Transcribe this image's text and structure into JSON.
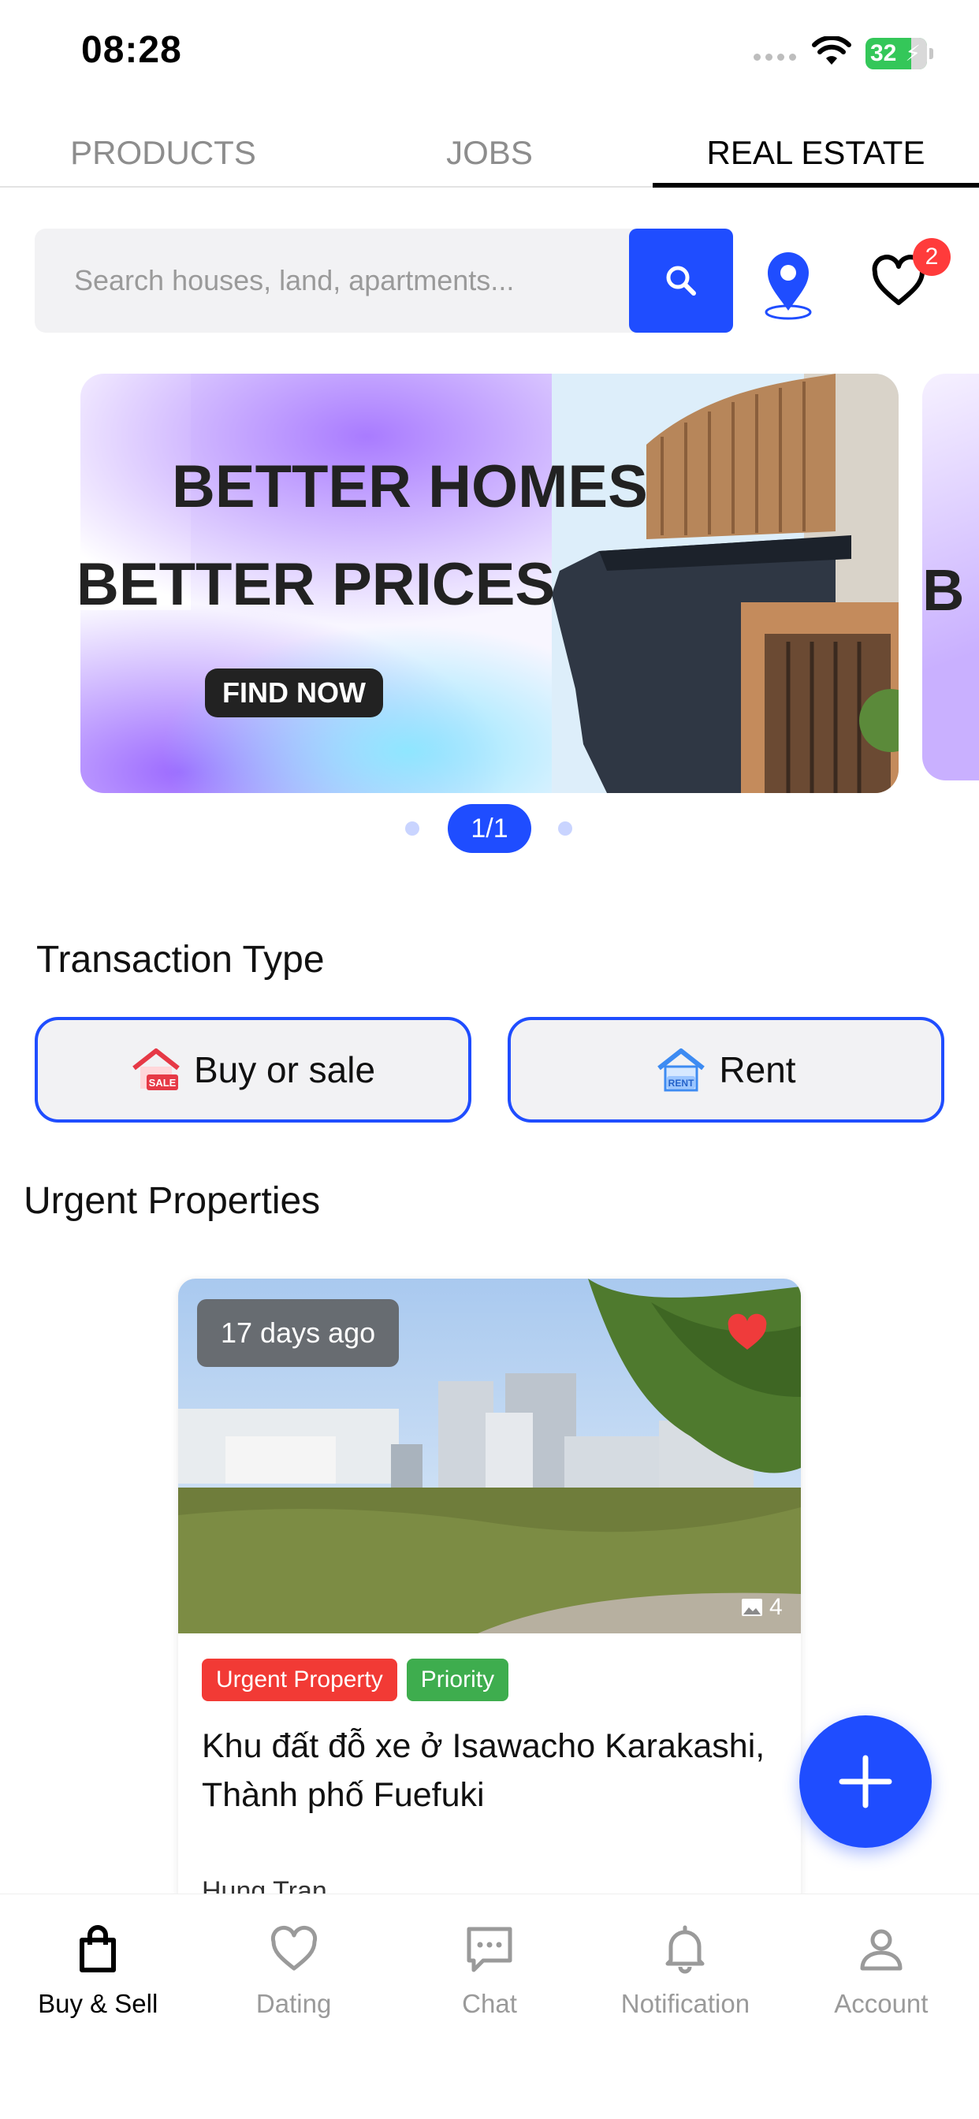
{
  "status_bar": {
    "time": "08:28",
    "battery": "32"
  },
  "top_tabs": [
    {
      "label": "PRODUCTS",
      "active": false
    },
    {
      "label": "JOBS",
      "active": false
    },
    {
      "label": "REAL ESTATE",
      "active": true
    }
  ],
  "search": {
    "placeholder": "Search houses, land, apartments...",
    "value": ""
  },
  "favorites": {
    "badge_count": "2"
  },
  "banner": {
    "line1": "BETTER HOMES",
    "line2": "BETTER PRICES",
    "cta": "FIND NOW",
    "next_peek": "B",
    "pager": "1/1"
  },
  "transaction": {
    "title": "Transaction Type",
    "buy_label": "Buy or sale",
    "buy_icon_text": "SALE",
    "rent_label": "Rent",
    "rent_icon_text": "RENT"
  },
  "urgent": {
    "title": "Urgent Properties",
    "card": {
      "time_ago": "17 days ago",
      "photo_count": "4",
      "tags": [
        "Urgent Property",
        "Priority"
      ],
      "tag_colors": [
        "#f23a35",
        "#3ead4e"
      ],
      "title": "Khu đất đỗ xe ở Isawacho Karakashi, Thành phố Fuefuki",
      "author": "Hung Tran",
      "favorited": true
    }
  },
  "bottom_nav": [
    {
      "label": "Buy & Sell",
      "icon": "shopping-bag-icon",
      "active": true
    },
    {
      "label": "Dating",
      "icon": "heart-outline-icon",
      "active": false
    },
    {
      "label": "Chat",
      "icon": "chat-bubble-icon",
      "active": false
    },
    {
      "label": "Notification",
      "icon": "bell-icon",
      "active": false
    },
    {
      "label": "Account",
      "icon": "user-icon",
      "active": false
    }
  ],
  "colors": {
    "accent": "#1f4dff",
    "badge": "#ff3b3b"
  }
}
